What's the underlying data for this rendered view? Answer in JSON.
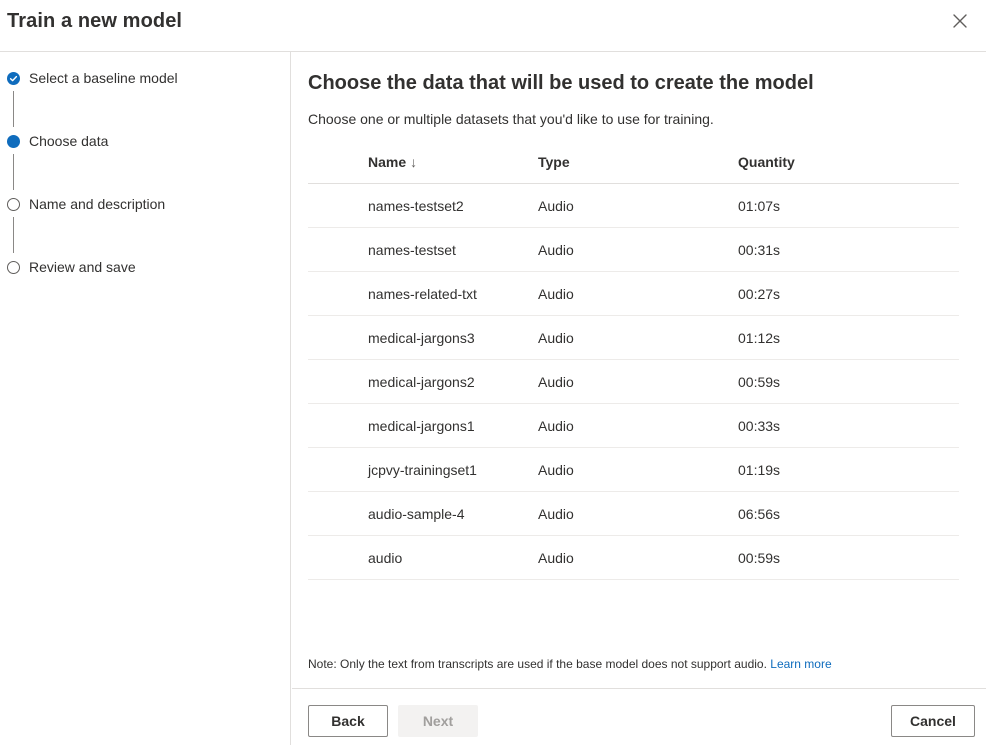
{
  "dialog": {
    "title": "Train a new model"
  },
  "wizard": {
    "steps": [
      {
        "label": "Select a baseline model",
        "state": "completed",
        "icon": "checkmark-circle-icon"
      },
      {
        "label": "Choose data",
        "state": "current",
        "icon": "filled-circle-icon"
      },
      {
        "label": "Name and description",
        "state": "pending",
        "icon": "empty-circle-icon"
      },
      {
        "label": "Review and save",
        "state": "pending",
        "icon": "empty-circle-icon"
      }
    ]
  },
  "main": {
    "title": "Choose the data that will be used to create the model",
    "subtitle": "Choose one or multiple datasets that you'd like to use for training.",
    "table": {
      "headers": {
        "name": "Name",
        "type": "Type",
        "quantity": "Quantity"
      },
      "sort": {
        "column": "name",
        "icon": "arrow-down-icon",
        "glyph": "↓"
      },
      "rows": [
        {
          "name": "names-testset2",
          "type": "Audio",
          "quantity": "01:07s"
        },
        {
          "name": "names-testset",
          "type": "Audio",
          "quantity": "00:31s"
        },
        {
          "name": "names-related-txt",
          "type": "Audio",
          "quantity": "00:27s"
        },
        {
          "name": "medical-jargons3",
          "type": "Audio",
          "quantity": "01:12s"
        },
        {
          "name": "medical-jargons2",
          "type": "Audio",
          "quantity": "00:59s"
        },
        {
          "name": "medical-jargons1",
          "type": "Audio",
          "quantity": "00:33s"
        },
        {
          "name": "jcpvy-trainingset1",
          "type": "Audio",
          "quantity": "01:19s"
        },
        {
          "name": "audio-sample-4",
          "type": "Audio",
          "quantity": "06:56s"
        },
        {
          "name": "audio",
          "type": "Audio",
          "quantity": "00:59s"
        }
      ]
    },
    "note": {
      "text": "Note: Only the text from transcripts are used if the base model does not support audio.",
      "link": "Learn more"
    }
  },
  "footer": {
    "back_label": "Back",
    "next_label": "Next",
    "cancel_label": "Cancel"
  },
  "colors": {
    "accent": "#0f6cbd",
    "text": "#323130",
    "border": "#e1dfdd",
    "disabled_bg": "#f3f2f1",
    "disabled_text": "#a19f9d"
  }
}
